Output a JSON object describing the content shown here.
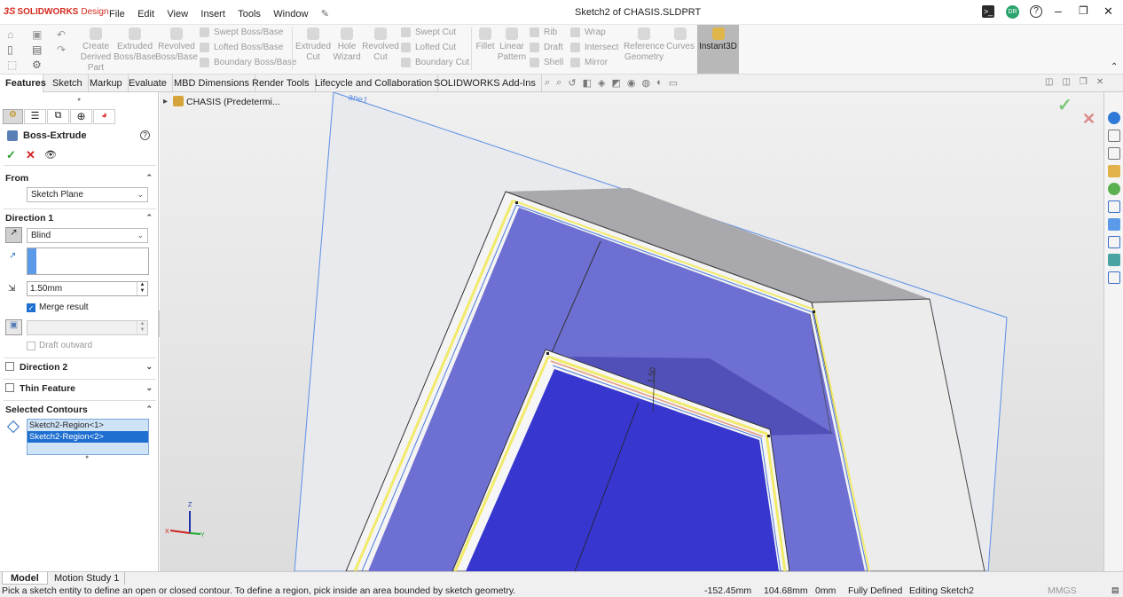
{
  "app": {
    "brand": "SOLIDWORKS",
    "brand_suffix": "Design",
    "window_title": "Sketch2 of CHASIS.SLDPRT",
    "user_initials": "DR"
  },
  "menu": [
    "File",
    "Edit",
    "View",
    "Insert",
    "Tools",
    "Window"
  ],
  "ribbon": {
    "create_derived_part": "Create Derived Part",
    "extruded_boss": "Extruded Boss/Base",
    "revolved_boss": "Revolved Boss/Base",
    "swept_boss": "Swept Boss/Base",
    "lofted_boss": "Lofted Boss/Base",
    "boundary_boss": "Boundary Boss/Base",
    "extruded_cut": "Extruded Cut",
    "hole_wizard": "Hole Wizard",
    "revolved_cut": "Revolved Cut",
    "swept_cut": "Swept Cut",
    "lofted_cut": "Lofted Cut",
    "boundary_cut": "Boundary Cut",
    "fillet": "Fillet",
    "linear_pattern": "Linear Pattern",
    "rib": "Rib",
    "draft": "Draft",
    "shell": "Shell",
    "wrap": "Wrap",
    "intersect": "Intersect",
    "mirror": "Mirror",
    "reference_geometry": "Reference Geometry",
    "curves": "Curves",
    "instant3d": "Instant3D"
  },
  "tabs": [
    "Features",
    "Sketch",
    "Markup",
    "Evaluate",
    "MBD Dimensions",
    "Render Tools",
    "Lifecycle and Collaboration",
    "SOLIDWORKS Add-Ins"
  ],
  "tree": {
    "root": "CHASIS (Predetermi..."
  },
  "pm": {
    "title": "Boss-Extrude",
    "from_label": "From",
    "from_value": "Sketch Plane",
    "direction1_label": "Direction 1",
    "end_condition": "Blind",
    "depth": "1.50mm",
    "merge_result": "Merge result",
    "merge_checked": true,
    "draft_outward": "Draft outward",
    "direction2_label": "Direction 2",
    "thin_feature_label": "Thin Feature",
    "selected_contours_label": "Selected Contours",
    "contours": [
      "Sketch2-Region<1>",
      "Sketch2-Region<2>"
    ],
    "selected_contour_index": 1
  },
  "viewport": {
    "dimension_label": "1.50",
    "plane_label": "ane1"
  },
  "triad": {
    "x": "X",
    "y": "Y",
    "z": "Z"
  },
  "bottom_tabs": [
    "Model",
    "Motion Study 1"
  ],
  "status": {
    "message": "Pick a sketch entity to define an open or closed contour. To define a region, pick inside an area bounded by sketch geometry.",
    "x": "-152.45mm",
    "y": "104.68mm",
    "z": "0mm",
    "state": "Fully Defined",
    "editing": "Editing Sketch2",
    "units": "MMGS"
  },
  "colors": {
    "accent": "#1f6fd1",
    "brand_red": "#d52b1e",
    "face_blue": "#6f6fd3",
    "face_dark": "#3a3ad0",
    "ok_green": "#2f9e2f",
    "cancel_red": "#d81f1f"
  }
}
